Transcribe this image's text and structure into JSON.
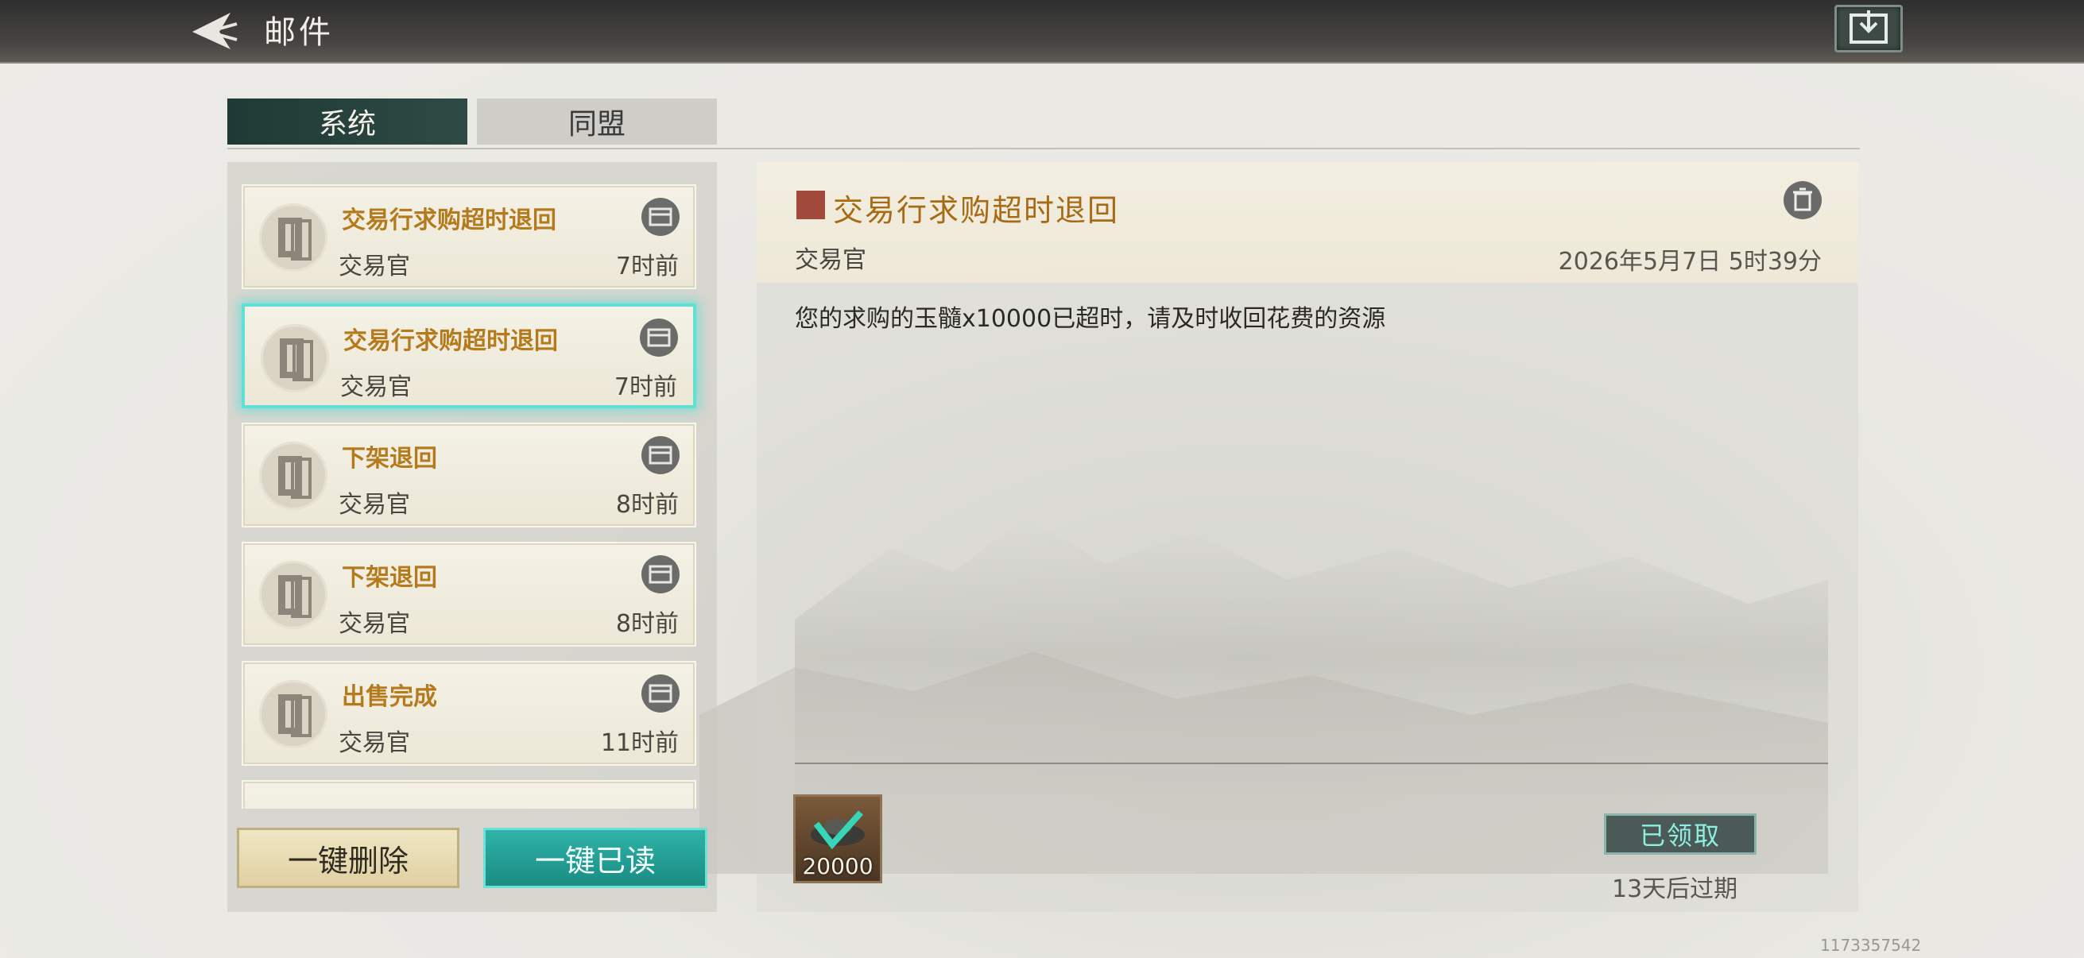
{
  "header": {
    "title": "邮件"
  },
  "tabs": [
    {
      "label": "系统",
      "active": true
    },
    {
      "label": "同盟",
      "active": false
    }
  ],
  "mail_list": [
    {
      "subject": "交易行求购超时退回",
      "sender": "交易官",
      "time": "7时前",
      "selected": false
    },
    {
      "subject": "交易行求购超时退回",
      "sender": "交易官",
      "time": "7时前",
      "selected": true
    },
    {
      "subject": "下架退回",
      "sender": "交易官",
      "time": "8时前",
      "selected": false
    },
    {
      "subject": "下架退回",
      "sender": "交易官",
      "time": "8时前",
      "selected": false
    },
    {
      "subject": "出售完成",
      "sender": "交易官",
      "time": "11时前",
      "selected": false
    }
  ],
  "buttons": {
    "delete_all": "一键删除",
    "read_all": "一键已读"
  },
  "detail": {
    "title": "交易行求购超时退回",
    "sender": "交易官",
    "date": "2026年5月7日 5时39分",
    "body": "您的求购的玉髓x10000已超时，请及时收回花费的资源",
    "reward_qty": "20000",
    "claim_status": "已领取",
    "expire_text": "13天后过期"
  },
  "footer": {
    "uid": "1173357542"
  },
  "colors": {
    "accent_teal": "#2fb3a8",
    "subject_gold": "#b57a1c",
    "tab_active": "#1e3a35"
  },
  "icons": [
    "back-arrow-icon",
    "inbox-download-icon",
    "scroll-icon",
    "chest-icon",
    "trash-icon",
    "seal-icon",
    "gold-ingot-icon",
    "check-icon"
  ]
}
